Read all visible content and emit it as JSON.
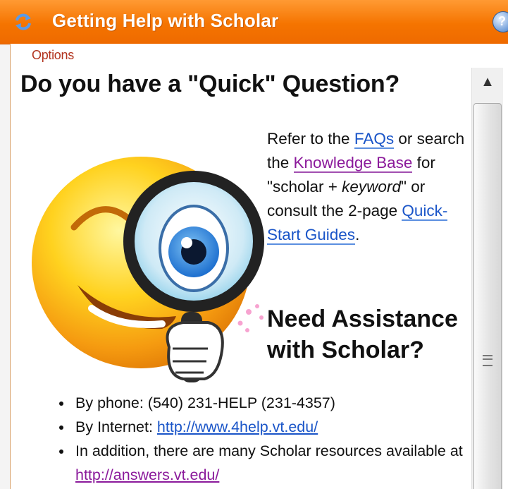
{
  "window": {
    "title": "Getting Help with Scholar",
    "options_label": "Options"
  },
  "quick": {
    "heading": "Do you have a \"Quick\" Question?",
    "text_1": "Refer to the ",
    "faqs_link": "FAQs",
    "text_2": " or search the ",
    "kb_link": "Knowledge Base",
    "text_3": " for \"scholar + ",
    "keyword": "keyword",
    "text_4": "\" or consult the 2-page ",
    "guides_link": "Quick-Start Guides",
    "text_5": "."
  },
  "assist": {
    "heading": "Need Assistance with Scholar?",
    "phone": "By phone: (540) 231-HELP (231-4357)",
    "internet_label": "By Internet: ",
    "internet_link": "http://www.4help.vt.edu/",
    "addition_text": "In addition, there are many Scholar resources available at ",
    "answers_link": "http://answers.vt.edu/"
  },
  "colors": {
    "titlebar": "#f57400",
    "link": "#1a55c8",
    "visited_link": "#8b1a9b",
    "options_text": "#b2331e"
  },
  "icons": {
    "title": "refresh-arrows-icon",
    "help": "help-globe-icon",
    "illustration": "winking-smiley-magnifier"
  }
}
